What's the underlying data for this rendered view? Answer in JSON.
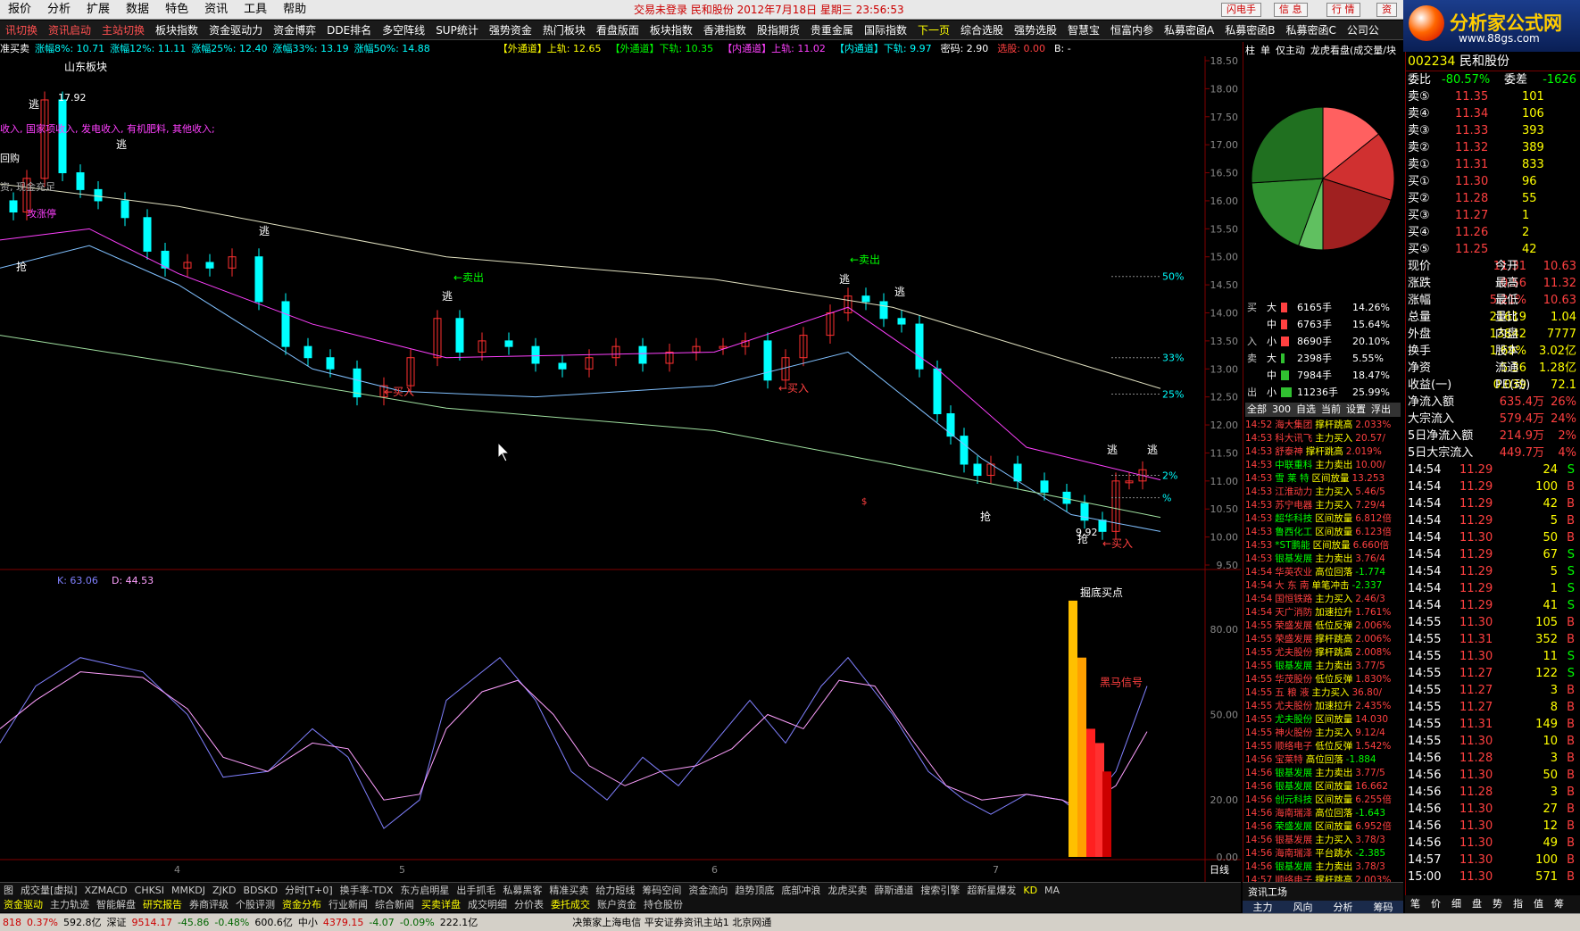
{
  "menu": {
    "items": [
      "报价",
      "分析",
      "扩展",
      "数据",
      "特色",
      "资讯",
      "工具",
      "帮助"
    ],
    "info": "交易未登录  民和股份  2012年7月18日  星期三  23:56:53",
    "buttons": [
      "闪电手",
      "信 息",
      "行 情",
      "资"
    ]
  },
  "logo": {
    "text": "分析家公式网",
    "url": "www.88gs.com"
  },
  "toolbar": {
    "items": [
      "讯切换",
      "资讯启动",
      "主站切换",
      "板块指数",
      "资金驱动力",
      "资金博弈",
      "DDE排名",
      "多空阵线",
      "SUP统计",
      "强势资金",
      "热门板块",
      "看盘版面",
      "板块指数",
      "香港指数",
      "股指期货",
      "贵重金属",
      "国际指数",
      "下一页",
      "综合选股",
      "强势选股",
      "智慧宝",
      "恒富内参",
      "私募密函A",
      "私募密函B",
      "私募密函C",
      "公司公"
    ]
  },
  "infobar": {
    "left": [
      "准买卖",
      "涨幅8%: 10.71",
      "涨幅12%: 11.11",
      "涨幅25%: 12.40",
      "涨幅33%: 13.19",
      "涨幅50%: 14.88"
    ],
    "right": [
      "【外通道】上轨: 12.65",
      "【外通道】下轨: 10.35",
      "【内通道】上轨: 11.02",
      "【内通道】下轨: 9.97",
      "密码: 2.90",
      "选股: 0.00",
      "B: -"
    ]
  },
  "annotations": {
    "block": "山东板块",
    "high": "17.92",
    "low": "9.92",
    "revenue": "收入, 国家项收入, 发电收入, 有机肥料, 其他收入;",
    "buyback": "回购",
    "cash": "资, 现金充足",
    "limit": "攻涨停",
    "escape": "逃",
    "grab": "抢",
    "buy": "←买入",
    "sell": "←卖出",
    "bottom": "掘底买点",
    "horse": "黑马信号",
    "pct": [
      "50%",
      "33%",
      "25%",
      "2%",
      "%"
    ],
    "dollar": "$"
  },
  "kd": {
    "k": "K: 63.06",
    "d": "D: 44.53"
  },
  "chart_data": {
    "type": "candlestick",
    "ylim": [
      9.5,
      18.5
    ],
    "yticks": [
      "18.50",
      "18.00",
      "17.50",
      "17.00",
      "16.50",
      "16.00",
      "15.50",
      "15.00",
      "14.50",
      "14.00",
      "13.50",
      "13.00",
      "12.50",
      "12.00",
      "11.50",
      "11.00",
      "10.50",
      "10.00",
      "9.50"
    ],
    "kd_ticks": [
      "80.00",
      "50.00",
      "20.00",
      "0.00"
    ],
    "xticks": [
      "4",
      "5",
      "6",
      "7"
    ],
    "period": "日线"
  },
  "bottom1": [
    "图",
    "成交量[虚拟]",
    "XZMACD",
    "CHKSI",
    "MMKDJ",
    "ZJKD",
    "BDSKD",
    "分时[T+0]",
    "换手率-TDX",
    "东方启明星",
    "出手抓毛",
    "私募黑客",
    "精准买卖",
    "给力短线",
    "筹码空间",
    "资金流向",
    "趋势顶底",
    "底部冲浪",
    "龙虎买卖",
    "薛斯通道",
    "搜索引擎",
    "超新星爆发",
    "KD",
    "MA"
  ],
  "bottom2": [
    "资金驱动",
    "主力轨迹",
    "智能解盘",
    "研究报告",
    "券商评级",
    "个股评测",
    "资金分布",
    "行业新闻",
    "综合新闻",
    "买卖详盘",
    "成交明细",
    "分价表",
    "委托成交",
    "账户资金",
    "持仓股份"
  ],
  "status": {
    "sh": "818",
    "sh_pct": "0.37%",
    "sh_amt": "592.8亿",
    "sz_label": "深证",
    "sz": "9514.17",
    "sz_chg": "-45.86",
    "sz_pct": "-0.48%",
    "sz_amt": "600.6亿",
    "zx_label": "中小",
    "zx": "4379.15",
    "zx_chg": "-4.07",
    "zx_pct": "-0.09%",
    "zx_amt": "222.1亿",
    "msg": "决策家上海电信  平安证券资讯主站1  北京网通"
  },
  "pietabs": [
    "柱",
    "单",
    "仅主动",
    "龙虎看盘(成交量/块"
  ],
  "moneyflow": [
    {
      "g": "买",
      "s": "大",
      "v": "6165手",
      "p": "14.26%",
      "c": "#ff4040"
    },
    {
      "g": "",
      "s": "中",
      "v": "6763手",
      "p": "15.64%",
      "c": "#ff4040"
    },
    {
      "g": "入",
      "s": "小",
      "v": "8690手",
      "p": "20.10%",
      "c": "#ff4040"
    },
    {
      "g": "卖",
      "s": "大",
      "v": "2398手",
      "p": "5.55%",
      "c": "#30c030"
    },
    {
      "g": "",
      "s": "中",
      "v": "7984手",
      "p": "18.47%",
      "c": "#30c030"
    },
    {
      "g": "出",
      "s": "小",
      "v": "11236手",
      "p": "25.99%",
      "c": "#30c030"
    }
  ],
  "newstabs": [
    "全部",
    "300",
    "自选",
    "当前",
    "设置",
    "浮出"
  ],
  "news": [
    [
      "14:52",
      "海大集团",
      "撑杆跳高",
      "2.033%"
    ],
    [
      "14:53",
      "科大讯飞",
      "主力买入",
      "20.57/"
    ],
    [
      "14:53",
      "舒泰神",
      "撑杆跳高",
      "2.019%"
    ],
    [
      "14:53",
      "中联重科",
      "主力卖出",
      "10.00/"
    ],
    [
      "14:53",
      "雪 莱 特",
      "区间放量",
      "13.253"
    ],
    [
      "14:53",
      "江淮动力",
      "主力买入",
      "5.46/5"
    ],
    [
      "14:53",
      "苏宁电器",
      "主力买入",
      "7.29/4"
    ],
    [
      "14:53",
      "超华科技",
      "区间放量",
      "6.812倍"
    ],
    [
      "14:53",
      "鲁西化工",
      "区间放量",
      "6.123倍"
    ],
    [
      "14:53",
      "*ST鹏能",
      "区间放量",
      "6.660倍"
    ],
    [
      "14:53",
      "银基发展",
      "主力卖出",
      "3.76/4"
    ],
    [
      "14:54",
      "华英农业",
      "高位回落",
      "-1.774"
    ],
    [
      "14:54",
      "大 东 南",
      "单笔冲击",
      "-2.337"
    ],
    [
      "14:54",
      "国恒铁路",
      "主力买入",
      "2.46/3"
    ],
    [
      "14:54",
      "天广消防",
      "加速拉升",
      "1.761%"
    ],
    [
      "14:55",
      "荣盛发展",
      "低位反弹",
      "2.006%"
    ],
    [
      "14:55",
      "荣盛发展",
      "撑杆跳高",
      "2.006%"
    ],
    [
      "14:55",
      "尤夫股份",
      "撑杆跳高",
      "2.008%"
    ],
    [
      "14:55",
      "银基发展",
      "主力卖出",
      "3.77/5"
    ],
    [
      "14:55",
      "华茂股份",
      "低位反弹",
      "1.830%"
    ],
    [
      "14:55",
      "五 粮 液",
      "主力买入",
      "36.80/"
    ],
    [
      "14:55",
      "尤夫股份",
      "加速拉升",
      "2.435%"
    ],
    [
      "14:55",
      "尤夫股份",
      "区间放量",
      "14.030"
    ],
    [
      "14:55",
      "神火股份",
      "主力买入",
      "9.12/4"
    ],
    [
      "14:55",
      "顺络电子",
      "低位反弹",
      "1.542%"
    ],
    [
      "14:56",
      "宝莱特",
      "高位回落",
      "-1.884"
    ],
    [
      "14:56",
      "银基发展",
      "主力卖出",
      "3.77/5"
    ],
    [
      "14:56",
      "银基发展",
      "区间放量",
      "16.662"
    ],
    [
      "14:56",
      "创元科技",
      "区间放量",
      "6.255倍"
    ],
    [
      "14:56",
      "海南瑞泽",
      "高位回落",
      "-1.643"
    ],
    [
      "14:56",
      "荣盛发展",
      "区间放量",
      "6.952倍"
    ],
    [
      "14:56",
      "银基发展",
      "主力买入",
      "3.78/3"
    ],
    [
      "14:56",
      "海南瑞泽",
      "平台跳水",
      "-2.385"
    ],
    [
      "14:56",
      "银基发展",
      "主力卖出",
      "3.78/3"
    ],
    [
      "14:57",
      "顺络电子",
      "撑杆跳高",
      "2.003%"
    ]
  ],
  "btabs3": [
    "资讯工场",
    "主力",
    "风向",
    "分析",
    "筹码"
  ],
  "quote": {
    "code": "002234",
    "name": "民和股份",
    "wb_label": "委比",
    "wb": "-80.57%",
    "wc_label": "委差",
    "wc": "-1626",
    "asks": [
      [
        "卖⑤",
        "11.35",
        "101"
      ],
      [
        "卖④",
        "11.34",
        "106"
      ],
      [
        "卖③",
        "11.33",
        "393"
      ],
      [
        "卖②",
        "11.32",
        "389"
      ],
      [
        "卖①",
        "11.31",
        "833"
      ]
    ],
    "bids": [
      [
        "买①",
        "11.30",
        "96"
      ],
      [
        "买②",
        "11.28",
        "55"
      ],
      [
        "买③",
        "11.27",
        "1"
      ],
      [
        "买④",
        "11.26",
        "2"
      ],
      [
        "买⑤",
        "11.25",
        "42"
      ]
    ],
    "stats": [
      [
        "现价",
        "11.31",
        "今开",
        "10.63"
      ],
      [
        "涨跌",
        "0.56",
        "最高",
        "11.32"
      ],
      [
        "涨幅",
        "5.21%",
        "最低",
        "10.63"
      ],
      [
        "总量",
        "21619",
        "量比",
        "1.04"
      ],
      [
        "外盘",
        "13842",
        "内盘",
        "7777"
      ],
      [
        "换手",
        "1.69%",
        "股本",
        "3.02亿"
      ],
      [
        "净资",
        "5.36",
        "流通",
        "1.28亿"
      ],
      [
        "收益(一)",
        "0.039",
        "PE(动)",
        "72.1"
      ]
    ],
    "flows": [
      [
        "净流入额",
        "635.4万",
        "26%"
      ],
      [
        "大宗流入",
        "579.4万",
        "24%"
      ],
      [
        "5日净流入额",
        "214.9万",
        "2%"
      ],
      [
        "5日大宗流入",
        "449.7万",
        "4%"
      ]
    ],
    "ticks": [
      [
        "14:54",
        "11.29",
        "24",
        "S"
      ],
      [
        "14:54",
        "11.29",
        "100",
        "B"
      ],
      [
        "14:54",
        "11.29",
        "42",
        "B"
      ],
      [
        "14:54",
        "11.29",
        "5",
        "B"
      ],
      [
        "14:54",
        "11.30",
        "50",
        "B"
      ],
      [
        "14:54",
        "11.29",
        "67",
        "S"
      ],
      [
        "14:54",
        "11.29",
        "5",
        "S"
      ],
      [
        "14:54",
        "11.29",
        "1",
        "S"
      ],
      [
        "14:54",
        "11.29",
        "41",
        "S"
      ],
      [
        "14:55",
        "11.30",
        "105",
        "B"
      ],
      [
        "14:55",
        "11.31",
        "352",
        "B"
      ],
      [
        "14:55",
        "11.30",
        "11",
        "S"
      ],
      [
        "14:55",
        "11.27",
        "122",
        "S"
      ],
      [
        "14:55",
        "11.27",
        "3",
        "B"
      ],
      [
        "14:55",
        "11.27",
        "8",
        "B"
      ],
      [
        "14:55",
        "11.31",
        "149",
        "B"
      ],
      [
        "14:55",
        "11.30",
        "10",
        "B"
      ],
      [
        "14:56",
        "11.28",
        "3",
        "B"
      ],
      [
        "14:56",
        "11.30",
        "50",
        "B"
      ],
      [
        "14:56",
        "11.28",
        "3",
        "B"
      ],
      [
        "14:56",
        "11.30",
        "27",
        "B"
      ],
      [
        "14:56",
        "11.30",
        "12",
        "B"
      ],
      [
        "14:56",
        "11.30",
        "49",
        "B"
      ],
      [
        "14:57",
        "11.30",
        "100",
        "B"
      ],
      [
        "15:00",
        "11.30",
        "571",
        "B"
      ]
    ]
  },
  "quotetabs": [
    "笔",
    "价",
    "细",
    "盘",
    "势",
    "指",
    "值",
    "筹"
  ],
  "colors": {
    "up": "#ff3030",
    "down": "#00ffff",
    "yellow": "#ffff00",
    "green": "#00ff00",
    "magenta": "#ff40ff"
  }
}
